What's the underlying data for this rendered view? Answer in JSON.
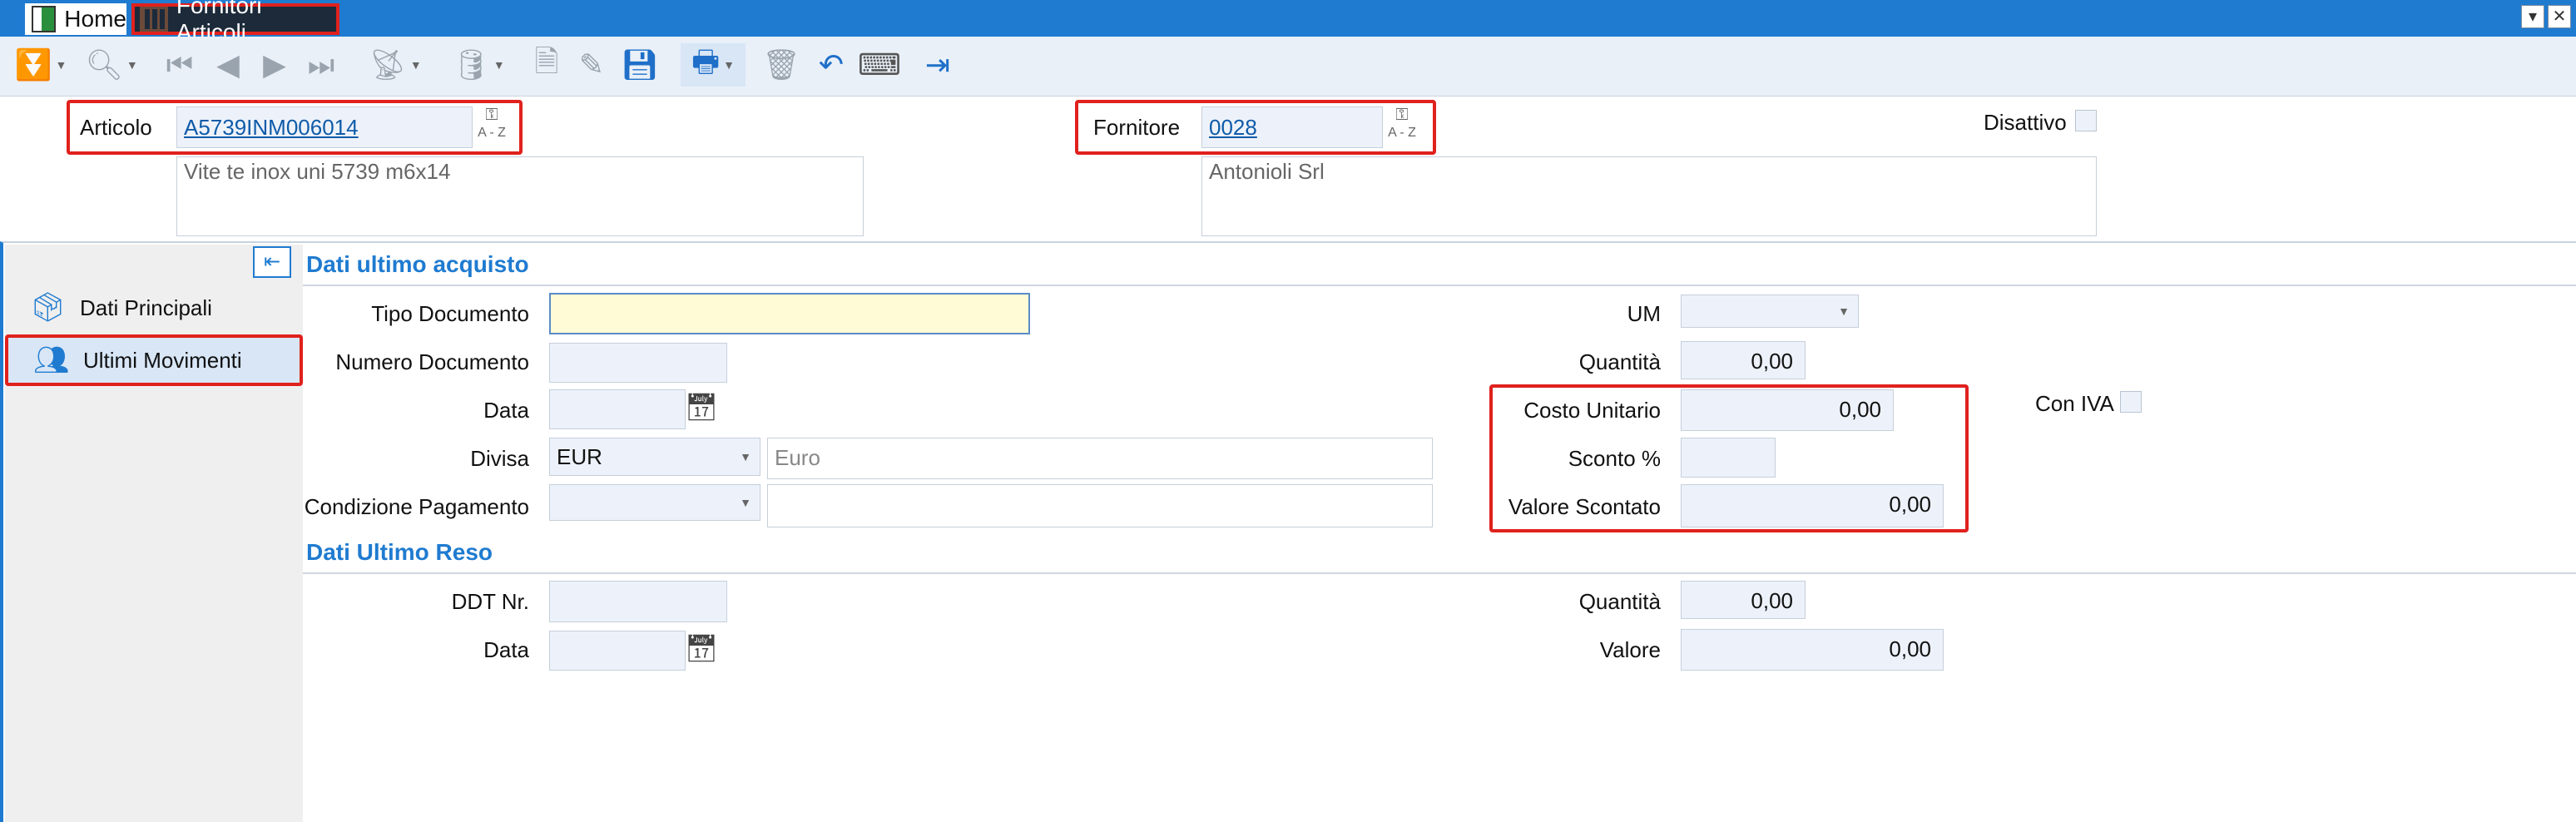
{
  "titlebar": {
    "tabs": [
      {
        "label": "Home",
        "icon": "home-app-icon"
      },
      {
        "label": "Fornitori Articoli",
        "icon": "table-icon"
      }
    ]
  },
  "toolbar": {
    "icons": [
      "expand-actions-icon",
      "search-icon",
      "first-record-icon",
      "previous-record-icon",
      "next-record-icon",
      "last-record-icon",
      "satellite-icon",
      "database-icon",
      "new-document-icon",
      "edit-icon",
      "save-icon",
      "print-icon",
      "delete-icon",
      "undo-icon",
      "keyboard-icon",
      "exit-icon"
    ]
  },
  "header": {
    "articolo_label": "Articolo",
    "articolo_value": "A5739INM006014",
    "articolo_desc": "Vite te inox uni 5739 m6x14",
    "fornitore_label": "Fornitore",
    "fornitore_value": "0028",
    "fornitore_desc": "Antonioli Srl",
    "disattivo_label": "Disattivo",
    "lookup_text": "A - Z"
  },
  "sidebar": {
    "items": [
      {
        "label": "Dati Principali",
        "icon": "package-icon"
      },
      {
        "label": "Ultimi Movimenti",
        "icon": "movements-icon"
      }
    ]
  },
  "section_last_purchase": {
    "title": "Dati ultimo acquisto",
    "tipo_documento_label": "Tipo Documento",
    "tipo_documento_value": "",
    "numero_documento_label": "Numero Documento",
    "numero_documento_value": "",
    "data_label": "Data",
    "data_value": "",
    "divisa_label": "Divisa",
    "divisa_value": "EUR",
    "divisa_desc": "Euro",
    "condizione_label": "Condizione Pagamento",
    "condizione_value": "",
    "um_label": "UM",
    "um_value": "",
    "quantita_label": "Quantità",
    "quantita_value": "0,00",
    "costo_label": "Costo Unitario",
    "costo_value": "0,00",
    "sconto_label": "Sconto %",
    "sconto_value": "",
    "valore_scontato_label": "Valore Scontato",
    "valore_scontato_value": "0,00",
    "con_iva_label": "Con IVA"
  },
  "section_last_return": {
    "title": "Dati Ultimo Reso",
    "ddt_label": "DDT Nr.",
    "ddt_value": "",
    "data_label": "Data",
    "data_value": "",
    "quantita_label": "Quantità",
    "quantita_value": "0,00",
    "valore_label": "Valore",
    "valore_value": "0,00"
  },
  "colors": {
    "accent": "#1f7bd0",
    "highlight_red": "#e0211d",
    "field_bg": "#edf2fa",
    "focus_bg": "#fffbd6"
  }
}
